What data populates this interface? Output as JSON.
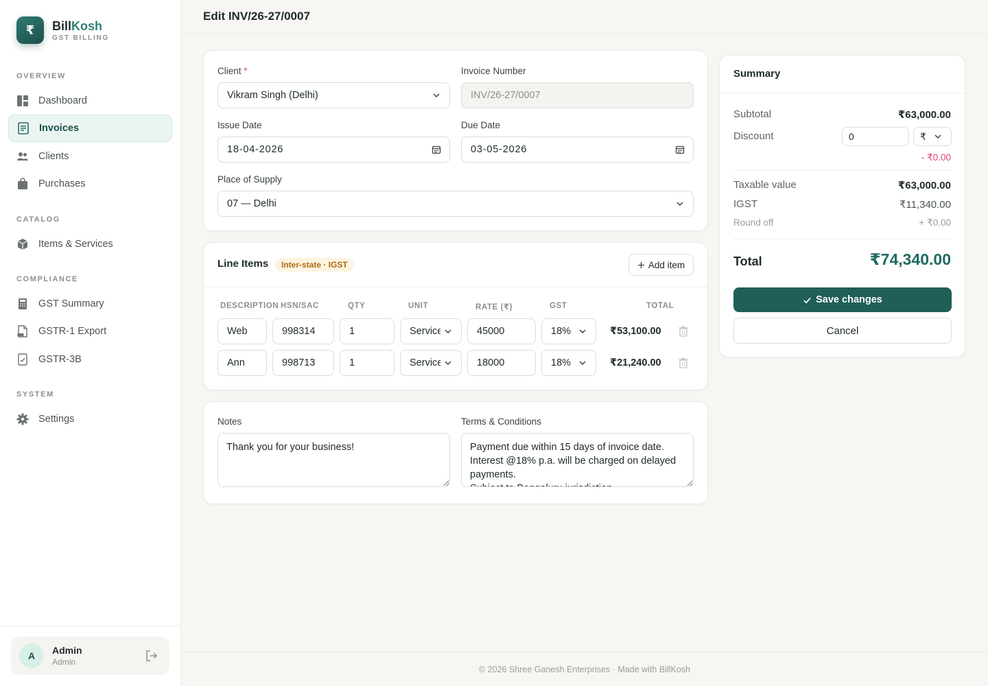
{
  "brand": {
    "logo_glyph": "₹",
    "name_part1": "Bill",
    "name_part2": "Kosh",
    "subtitle": "GST BILLING"
  },
  "nav": {
    "overview": "OVERVIEW",
    "catalog": "CATALOG",
    "compliance": "COMPLIANCE",
    "system": "SYSTEM",
    "items": {
      "dashboard": "Dashboard",
      "invoices": "Invoices",
      "clients": "Clients",
      "purchases": "Purchases",
      "items_services": "Items & Services",
      "gst_summary": "GST Summary",
      "gstr1": "GSTR-1 Export",
      "gstr3b": "GSTR-3B",
      "settings": "Settings"
    }
  },
  "user": {
    "initial": "A",
    "name": "Admin",
    "role": "Admin"
  },
  "page": {
    "title": "Edit INV/26-27/0007"
  },
  "form": {
    "client_label": "Client",
    "client_req": "*",
    "client_value": "Vikram Singh (Delhi)",
    "invoice_number_label": "Invoice Number",
    "invoice_number_value": "INV/26-27/0007",
    "issue_date_label": "Issue Date",
    "issue_date_value": "18-04-2026",
    "due_date_label": "Due Date",
    "due_date_value": "03-05-2026",
    "place_label": "Place of Supply",
    "place_value": "07 — Delhi"
  },
  "line_items": {
    "title": "Line Items",
    "badge": "Inter-state · IGST",
    "add_label": "Add item",
    "headers": {
      "description": "DESCRIPTION",
      "hsn": "HSN/SAC",
      "qty": "QTY",
      "unit": "UNIT",
      "rate": "RATE (₹)",
      "gst": "GST",
      "total": "TOTAL"
    },
    "rows": [
      {
        "description": "Web",
        "hsn": "998314",
        "qty": "1",
        "unit": "Service",
        "rate": "45000",
        "gst": "18%",
        "total": "₹53,100.00"
      },
      {
        "description": "Ann",
        "hsn": "998713",
        "qty": "1",
        "unit": "Service",
        "rate": "18000",
        "gst": "18%",
        "total": "₹21,240.00"
      }
    ]
  },
  "notes": {
    "notes_label": "Notes",
    "notes_value": "Thank you for your business!",
    "terms_label": "Terms & Conditions",
    "terms_value": "Payment due within 15 days of invoice date.\nInterest @18% p.a. will be charged on delayed payments.\nSubject to Bengaluru jurisdiction."
  },
  "summary": {
    "title": "Summary",
    "subtotal_label": "Subtotal",
    "subtotal_value": "₹63,000.00",
    "discount_label": "Discount",
    "discount_value": "0",
    "discount_unit": "₹",
    "discount_amount": "- ₹0.00",
    "taxable_label": "Taxable value",
    "taxable_value": "₹63,000.00",
    "igst_label": "IGST",
    "igst_value": "₹11,340.00",
    "roundoff_label": "Round off",
    "roundoff_value": "+ ₹0.00",
    "total_label": "Total",
    "total_value": "₹74,340.00",
    "save_label": "Save changes",
    "cancel_label": "Cancel"
  },
  "footer": {
    "text": "© 2026 Shree Ganesh Enterprises · Made with BillKosh"
  },
  "colors": {
    "brand": "#205e58",
    "accent": "#2f8077",
    "negative": "#e0457b",
    "badge_bg": "#fdf4e0"
  }
}
